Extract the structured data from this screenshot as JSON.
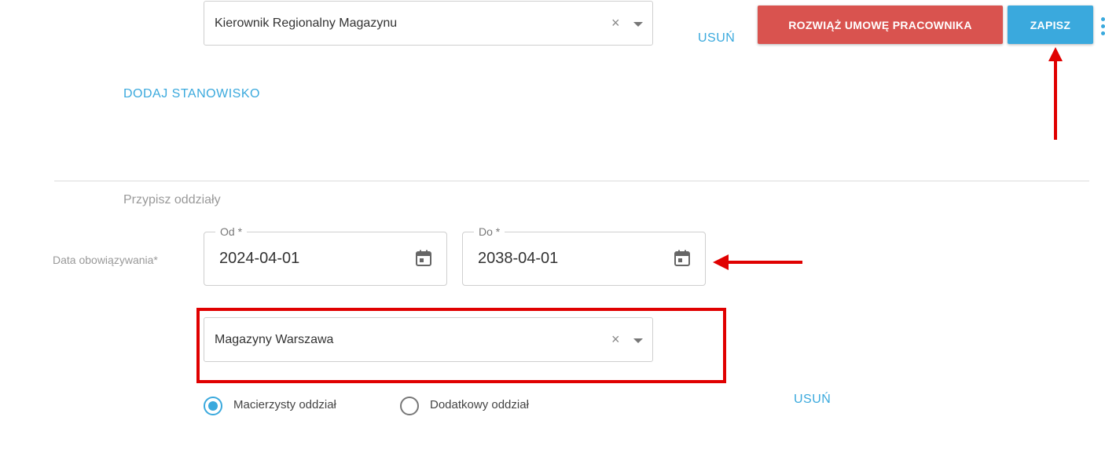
{
  "position": {
    "selected": "Kierownik Regionalny Magazynu",
    "clear_symbol": "×",
    "remove_label": "USUŃ"
  },
  "actions": {
    "terminate_label": "ROZWIĄŻ UMOWĘ PRACOWNIKA",
    "save_label": "ZAPISZ",
    "terminate_color": "#d9534f",
    "save_color": "#3aa9dd"
  },
  "add_position_label": "DODAJ STANOWISKO",
  "branches": {
    "section_title": "Przypisz oddziały",
    "validity_label": "Data obowiązywania*",
    "from": {
      "legend": "Od *",
      "value": "2024-04-01"
    },
    "to": {
      "legend": "Do *",
      "value": "2038-04-01"
    },
    "selected_branch": "Magazyny Warszawa",
    "clear_symbol": "×",
    "radio_options": [
      {
        "label": "Macierzysty oddział",
        "checked": true
      },
      {
        "label": "Dodatkowy oddział",
        "checked": false
      }
    ],
    "remove_label": "USUŃ"
  },
  "annotation_color": "#e00000"
}
